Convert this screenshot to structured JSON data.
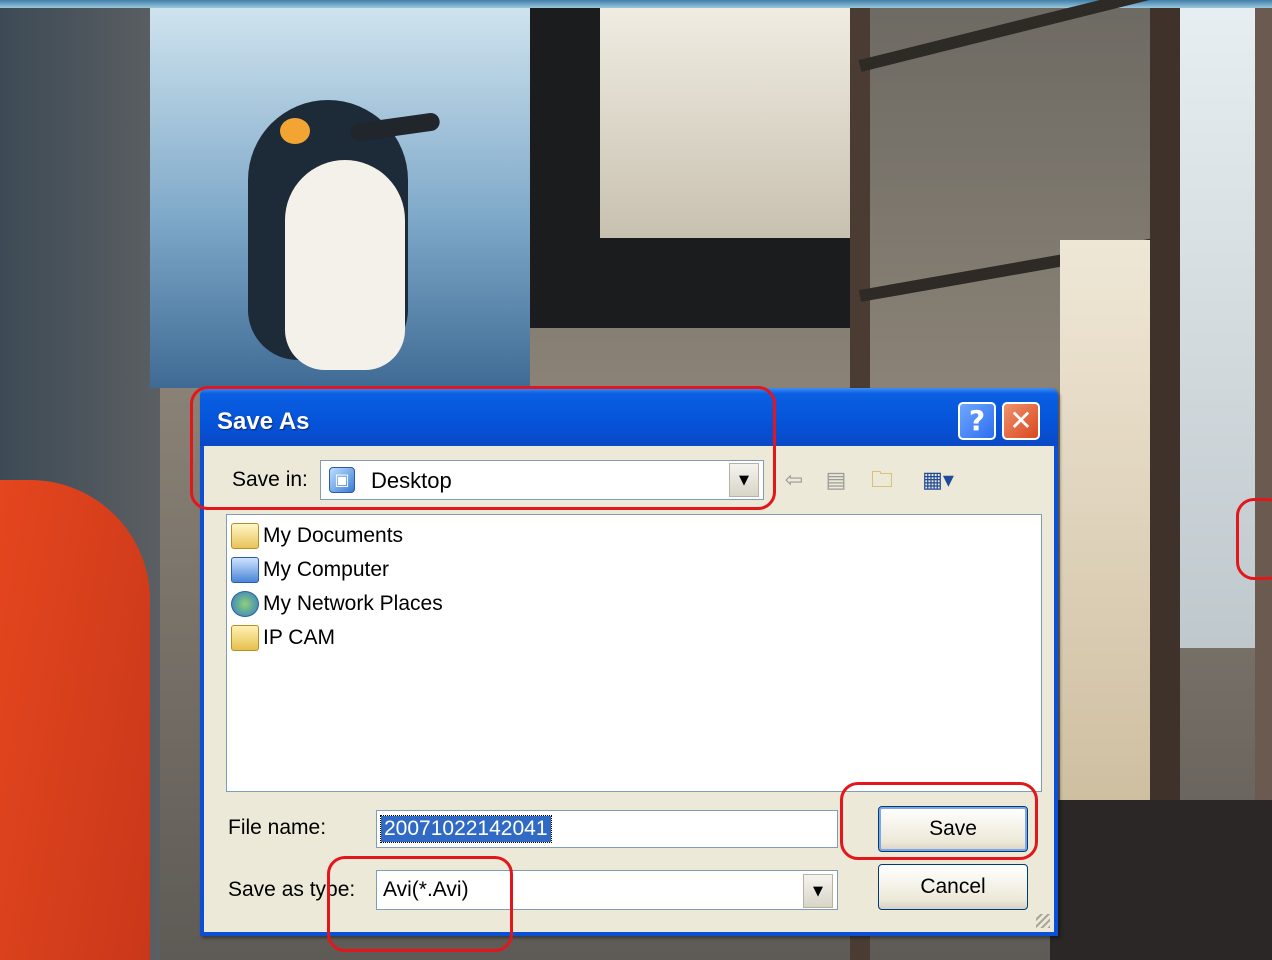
{
  "dialog": {
    "title": "Save As",
    "help_glyph": "?",
    "close_glyph": "✕",
    "save_in_label": "Save in:",
    "save_in_value": "Desktop",
    "files": [
      {
        "name": "My Documents",
        "icon": "my-documents-icon"
      },
      {
        "name": "My Computer",
        "icon": "my-computer-icon"
      },
      {
        "name": "My Network Places",
        "icon": "network-places-icon"
      },
      {
        "name": "IP CAM",
        "icon": "folder-icon"
      }
    ],
    "file_name_label": "File name:",
    "file_name_value": "20071022142041",
    "save_type_label": "Save as type:",
    "save_type_value": "Avi(*.Avi)",
    "save_button": "Save",
    "cancel_button": "Cancel"
  },
  "colors": {
    "annotation_red": "#e3161b",
    "xp_blue": "#0a4fd6",
    "dialog_bg": "#ece9d8"
  }
}
